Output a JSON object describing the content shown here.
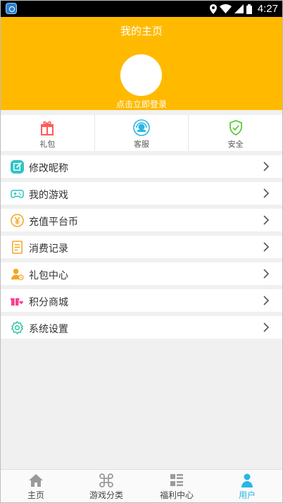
{
  "status_bar": {
    "time": "4:27",
    "icons": [
      "location-icon",
      "wifi-icon",
      "signal-icon",
      "battery-icon"
    ]
  },
  "header": {
    "title": "我的主页",
    "login_text": "点击立即登录",
    "background_color": "#ffba00"
  },
  "quick_actions": [
    {
      "label": "礼包",
      "icon": "gift-icon",
      "color": "#ff5a5a"
    },
    {
      "label": "客服",
      "icon": "customer-service-icon",
      "color": "#29b6e6"
    },
    {
      "label": "安全",
      "icon": "shield-check-icon",
      "color": "#5ccc3a"
    }
  ],
  "menu": [
    {
      "label": "修改昵称",
      "icon": "edit-icon",
      "color": "#2ec4c4"
    },
    {
      "label": "我的游戏",
      "icon": "gamepad-icon",
      "color": "#2ec4c4"
    },
    {
      "label": "充值平台币",
      "icon": "yen-coin-icon",
      "color": "#f5a623"
    },
    {
      "label": "消费记录",
      "icon": "receipt-icon",
      "color": "#f5a623"
    },
    {
      "label": "礼包中心",
      "icon": "user-gift-icon",
      "color": "#f5a623"
    },
    {
      "label": "积分商城",
      "icon": "points-gift-icon",
      "color": "#ff3b8d"
    },
    {
      "label": "系统设置",
      "icon": "settings-icon",
      "color": "#2ec4a0"
    }
  ],
  "tabs": [
    {
      "label": "主页",
      "icon": "home-icon",
      "active": false
    },
    {
      "label": "游戏分类",
      "icon": "command-icon",
      "active": false
    },
    {
      "label": "福利中心",
      "icon": "list-grid-icon",
      "active": false
    },
    {
      "label": "用户",
      "icon": "user-icon",
      "active": true
    }
  ],
  "accent_color": "#29b6e6"
}
